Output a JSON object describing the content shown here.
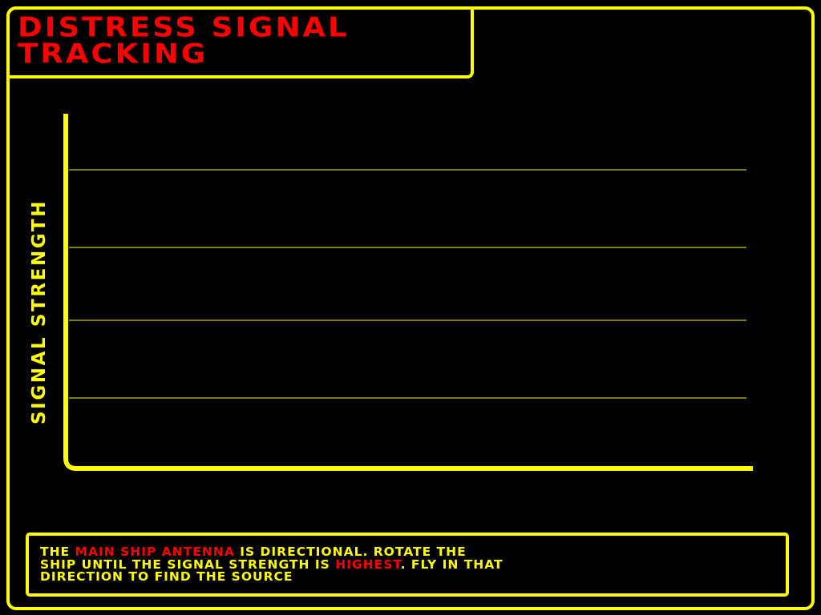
{
  "title": {
    "line1": "DISTRESS SIGNAL",
    "line2": "TRACKING"
  },
  "chart": {
    "y_axis_label": "SIGNAL STRENGTH",
    "gridline_count": 4,
    "axis_color": "#ffff00"
  },
  "instructions": {
    "line1_prefix": "THE ",
    "line1_highlight": "MAIN SHIP ANTENNA",
    "line1_suffix": " IS DIRECTIONAL. ROTATE THE",
    "line2_prefix": "SHIP UNTIL THE SIGNAL STRENGTH IS ",
    "line2_highlight": "HIGHEST",
    "line2_suffix": ". FLY IN THAT",
    "line3": "DIRECTION TO FIND THE SOURCE"
  },
  "colors": {
    "background": "#000000",
    "accent": "#ffff00",
    "highlight": "#ff0000"
  }
}
